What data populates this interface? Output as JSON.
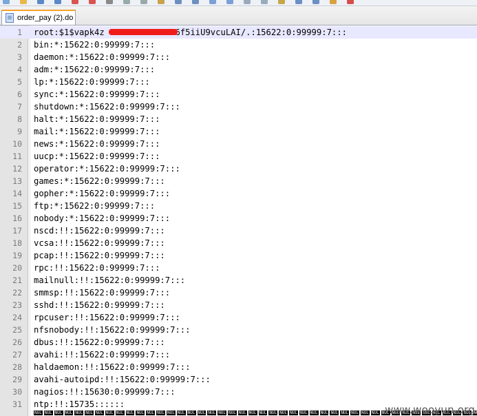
{
  "toolbar": {
    "icons": [
      "new-file-icon",
      "open-icon",
      "save-icon",
      "save-all-icon",
      "close-icon",
      "close-all-icon",
      "print-icon",
      "cut-icon",
      "copy-icon",
      "paste-icon",
      "undo-icon",
      "redo-icon",
      "find-icon",
      "replace-icon",
      "zoom-in-icon",
      "zoom-out-icon",
      "sync-icon",
      "wrap-icon",
      "indent-guide-icon",
      "user-lang-icon",
      "record-macro-icon"
    ]
  },
  "tab": {
    "title": "order_pay (2).do"
  },
  "lines": [
    {
      "n": "1",
      "text": "root:$1$vapk4z              6f5iiU9vcuLAI/.:15622:0:99999:7:::"
    },
    {
      "n": "2",
      "text": "bin:*:15622:0:99999:7:::"
    },
    {
      "n": "3",
      "text": "daemon:*:15622:0:99999:7:::"
    },
    {
      "n": "4",
      "text": "adm:*:15622:0:99999:7:::"
    },
    {
      "n": "5",
      "text": "lp:*:15622:0:99999:7:::"
    },
    {
      "n": "6",
      "text": "sync:*:15622:0:99999:7:::"
    },
    {
      "n": "7",
      "text": "shutdown:*:15622:0:99999:7:::"
    },
    {
      "n": "8",
      "text": "halt:*:15622:0:99999:7:::"
    },
    {
      "n": "9",
      "text": "mail:*:15622:0:99999:7:::"
    },
    {
      "n": "10",
      "text": "news:*:15622:0:99999:7:::"
    },
    {
      "n": "11",
      "text": "uucp:*:15622:0:99999:7:::"
    },
    {
      "n": "12",
      "text": "operator:*:15622:0:99999:7:::"
    },
    {
      "n": "13",
      "text": "games:*:15622:0:99999:7:::"
    },
    {
      "n": "14",
      "text": "gopher:*:15622:0:99999:7:::"
    },
    {
      "n": "15",
      "text": "ftp:*:15622:0:99999:7:::"
    },
    {
      "n": "16",
      "text": "nobody:*:15622:0:99999:7:::"
    },
    {
      "n": "17",
      "text": "nscd:!!:15622:0:99999:7:::"
    },
    {
      "n": "18",
      "text": "vcsa:!!:15622:0:99999:7:::"
    },
    {
      "n": "19",
      "text": "pcap:!!:15622:0:99999:7:::"
    },
    {
      "n": "20",
      "text": "rpc:!!:15622:0:99999:7:::"
    },
    {
      "n": "21",
      "text": "mailnull:!!:15622:0:99999:7:::"
    },
    {
      "n": "22",
      "text": "smmsp:!!:15622:0:99999:7:::"
    },
    {
      "n": "23",
      "text": "sshd:!!:15622:0:99999:7:::"
    },
    {
      "n": "24",
      "text": "rpcuser:!!:15622:0:99999:7:::"
    },
    {
      "n": "25",
      "text": "nfsnobody:!!:15622:0:99999:7:::"
    },
    {
      "n": "26",
      "text": "dbus:!!:15622:0:99999:7:::"
    },
    {
      "n": "27",
      "text": "avahi:!!:15622:0:99999:7:::"
    },
    {
      "n": "28",
      "text": "haldaemon:!!:15622:0:99999:7:::"
    },
    {
      "n": "29",
      "text": "avahi-autoipd:!!:15622:0:99999:7:::"
    },
    {
      "n": "30",
      "text": "nagios:!!:15630:0:99999:7:::"
    },
    {
      "n": "31",
      "text": "ntp:!!:15735::::::"
    }
  ],
  "nul_row": [
    "NUL",
    "NUL",
    "NUL",
    "NUL",
    "NUL",
    "NUL",
    "NUL",
    "NUL",
    "NUL",
    "NUL",
    "NUL",
    "NUL",
    "NUL",
    "NUL",
    "NUL",
    "NUL",
    "NUL",
    "NUL",
    "NUL",
    "NUL",
    "NUL",
    "NUL",
    "NUL",
    "NUL",
    "NUL",
    "NUL",
    "NUL",
    "NUL",
    "NUL",
    "NUL",
    "NUL",
    "NUL",
    "NUL",
    "NUL",
    "NUL",
    "NUL",
    "NUL",
    "NUL",
    "NUL",
    "NUL",
    "NUL",
    "NUL",
    "NUL",
    "NUL",
    "NUL",
    "NUL",
    "NUL",
    "NUL",
    "NUL",
    "NUL",
    "NUL",
    "NUL",
    "NUL",
    "NUL",
    "NUL",
    "NUL",
    "NUL",
    "NUL",
    "NUL",
    "NUL",
    "NUL",
    "NUL",
    "NUL",
    "NUL",
    "NUL",
    "NUL",
    "NUL",
    "NUL",
    "NUL",
    "NUL",
    "NUL",
    "NUL",
    "NUL",
    "NUL",
    "NUL",
    "NUL",
    "NUL",
    "NUL",
    "NUL",
    "NUL"
  ],
  "watermark": "www.wooyun.org",
  "colors": {
    "current_line": "#e8e8ff",
    "gutter": "#e4e4e4",
    "redaction": "#f01c1c",
    "active_tab_accent": "#f6a22d"
  }
}
